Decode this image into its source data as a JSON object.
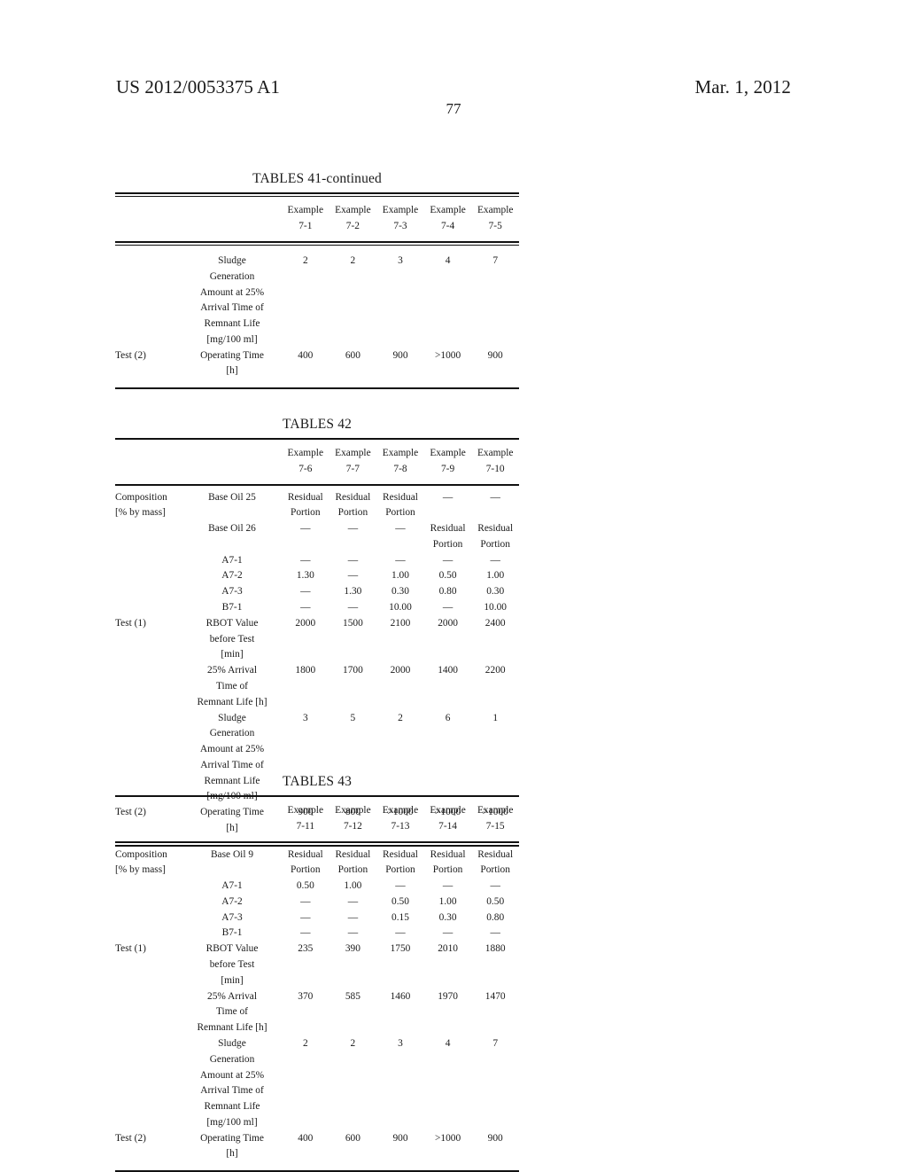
{
  "header": {
    "publication_number": "US 2012/0053375 A1",
    "date": "Mar. 1, 2012",
    "page_number": "77"
  },
  "tables": [
    {
      "caption": "TABLES 41-continued",
      "column_headers": [
        "Example\n7-1",
        "Example\n7-2",
        "Example\n7-3",
        "Example\n7-4",
        "Example\n7-5"
      ],
      "rows": [
        {
          "label1": "",
          "label2": "Sludge\nGeneration\nAmount at 25%\nArrival Time of\nRemnant Life\n[mg/100 ml]",
          "values": [
            "2",
            "2",
            "3",
            "4",
            "7"
          ]
        },
        {
          "label1": "Test (2)",
          "label2": "Operating Time\n[h]",
          "values": [
            "400",
            "600",
            "900",
            ">1000",
            "900"
          ]
        }
      ]
    },
    {
      "caption": "TABLES 42",
      "column_headers": [
        "Example\n7-6",
        "Example\n7-7",
        "Example\n7-8",
        "Example\n7-9",
        "Example\n7-10"
      ],
      "rows": [
        {
          "label1": "Composition\n[% by mass]",
          "label2": "Base Oil 25",
          "values": [
            "Residual\nPortion",
            "Residual\nPortion",
            "Residual\nPortion",
            "—",
            "—"
          ]
        },
        {
          "label1": "",
          "label2": "Base Oil 26",
          "values": [
            "—",
            "—",
            "—",
            "Residual\nPortion",
            "Residual\nPortion"
          ]
        },
        {
          "label1": "",
          "label2": "A7-1",
          "values": [
            "—",
            "—",
            "—",
            "—",
            "—"
          ]
        },
        {
          "label1": "",
          "label2": "A7-2",
          "values": [
            "1.30",
            "—",
            "1.00",
            "0.50",
            "1.00"
          ]
        },
        {
          "label1": "",
          "label2": "A7-3",
          "values": [
            "—",
            "1.30",
            "0.30",
            "0.80",
            "0.30"
          ]
        },
        {
          "label1": "",
          "label2": "B7-1",
          "values": [
            "—",
            "—",
            "10.00",
            "—",
            "10.00"
          ]
        },
        {
          "label1": "Test (1)",
          "label2": "RBOT Value\nbefore Test\n[min]",
          "values": [
            "2000",
            "1500",
            "2100",
            "2000",
            "2400"
          ]
        },
        {
          "label1": "",
          "label2": "25% Arrival\nTime of\nRemnant Life [h]",
          "values": [
            "1800",
            "1700",
            "2000",
            "1400",
            "2200"
          ]
        },
        {
          "label1": "",
          "label2": "Sludge\nGeneration\nAmount at 25%\nArrival Time of\nRemnant Life\n[mg/100 ml]",
          "values": [
            "3",
            "5",
            "2",
            "6",
            "1"
          ]
        },
        {
          "label1": "Test (2)",
          "label2": "Operating Time\n[h]",
          "values": [
            "900",
            "800",
            ">1000",
            ">1000",
            ">1000"
          ]
        }
      ]
    },
    {
      "caption": "TABLES 43",
      "column_headers": [
        "Example\n7-11",
        "Example\n7-12",
        "Example\n7-13",
        "Example\n7-14",
        "Example\n7-15"
      ],
      "rows": [
        {
          "label1": "Composition\n[% by mass]",
          "label2": "Base Oil 9",
          "values": [
            "Residual\nPortion",
            "Residual\nPortion",
            "Residual\nPortion",
            "Residual\nPortion",
            "Residual\nPortion"
          ]
        },
        {
          "label1": "",
          "label2": "A7-1",
          "values": [
            "0.50",
            "1.00",
            "—",
            "—",
            "—"
          ]
        },
        {
          "label1": "",
          "label2": "A7-2",
          "values": [
            "—",
            "—",
            "0.50",
            "1.00",
            "0.50"
          ]
        },
        {
          "label1": "",
          "label2": "A7-3",
          "values": [
            "—",
            "—",
            "0.15",
            "0.30",
            "0.80"
          ]
        },
        {
          "label1": "",
          "label2": "B7-1",
          "values": [
            "—",
            "—",
            "—",
            "—",
            "—"
          ]
        },
        {
          "label1": "Test (1)",
          "label2": "RBOT Value\nbefore Test\n[min]",
          "values": [
            "235",
            "390",
            "1750",
            "2010",
            "1880"
          ]
        },
        {
          "label1": "",
          "label2": "25% Arrival\nTime of\nRemnant Life [h]",
          "values": [
            "370",
            "585",
            "1460",
            "1970",
            "1470"
          ]
        },
        {
          "label1": "",
          "label2": "Sludge\nGeneration\nAmount at 25%\nArrival Time of\nRemnant Life\n[mg/100 ml]",
          "values": [
            "2",
            "2",
            "3",
            "4",
            "7"
          ]
        },
        {
          "label1": "Test (2)",
          "label2": "Operating Time\n[h]",
          "values": [
            "400",
            "600",
            "900",
            ">1000",
            "900"
          ]
        }
      ]
    }
  ]
}
